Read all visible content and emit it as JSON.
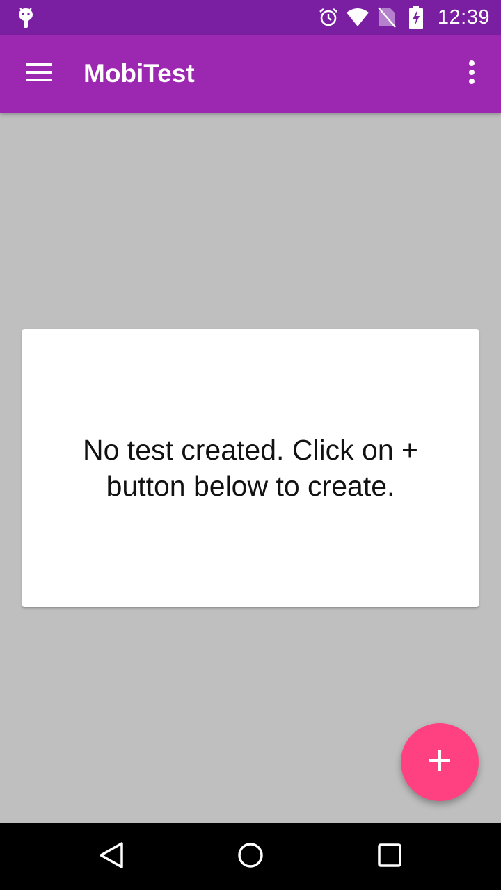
{
  "status_bar": {
    "time": "12:39",
    "icons": [
      "android-debug-icon",
      "alarm-icon",
      "wifi-icon",
      "no-sim-icon",
      "battery-charging-icon"
    ]
  },
  "app_bar": {
    "title": "MobiTest",
    "menu_icon": "hamburger-menu-icon",
    "overflow_icon": "more-vertical-icon"
  },
  "empty_state": {
    "message": "No test created. Click on + button below to create."
  },
  "fab": {
    "icon": "plus-icon"
  },
  "nav_bar": {
    "buttons": [
      "back-icon",
      "home-icon",
      "recents-icon"
    ]
  },
  "colors": {
    "status_bar": "#7b1fa2",
    "app_bar": "#9c27b0",
    "background": "#bfbfbf",
    "fab": "#ff4081",
    "nav_bar": "#000000"
  }
}
